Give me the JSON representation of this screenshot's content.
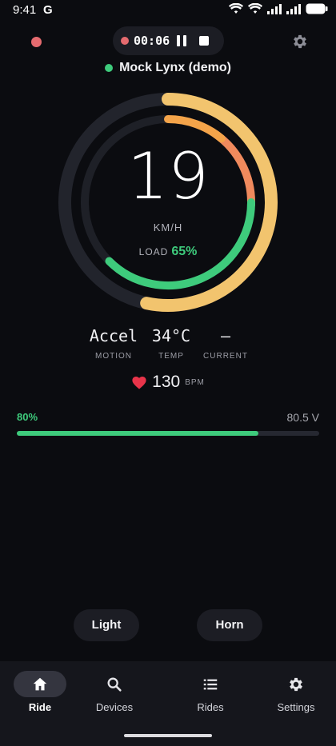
{
  "status_bar": {
    "time": "9:41",
    "g_label": "G"
  },
  "recording": {
    "elapsed": "00:06"
  },
  "device": {
    "name": "Mock Lynx (demo)",
    "status_color": "#3ecb7c"
  },
  "gauge": {
    "speed": "19",
    "unit": "KM/H",
    "load_label": "LOAD",
    "load_value": "65%",
    "load_fraction": 0.65
  },
  "stats": [
    {
      "value": "Accel",
      "label": "MOTION"
    },
    {
      "value": "34°C",
      "label": "TEMP"
    },
    {
      "value": "—",
      "label": "CURRENT"
    }
  ],
  "heart_rate": {
    "value": "130",
    "unit": "BPM"
  },
  "battery": {
    "percent": "80%",
    "fraction": 0.8,
    "voltage": "80.5 V"
  },
  "actions": {
    "light": "Light",
    "horn": "Horn"
  },
  "nav": [
    {
      "label": "Ride",
      "icon": "home-icon",
      "active": true
    },
    {
      "label": "Devices",
      "icon": "search-icon",
      "active": false
    },
    {
      "label": "Rides",
      "icon": "list-icon",
      "active": false
    },
    {
      "label": "Settings",
      "icon": "gear-icon",
      "active": false
    }
  ],
  "colors": {
    "accent": "#3ecb7c",
    "record": "#e56b6f",
    "outer_arc": "#f2c46e",
    "inner_arc_hot": "#f08a5d",
    "background": "#0b0c10"
  }
}
